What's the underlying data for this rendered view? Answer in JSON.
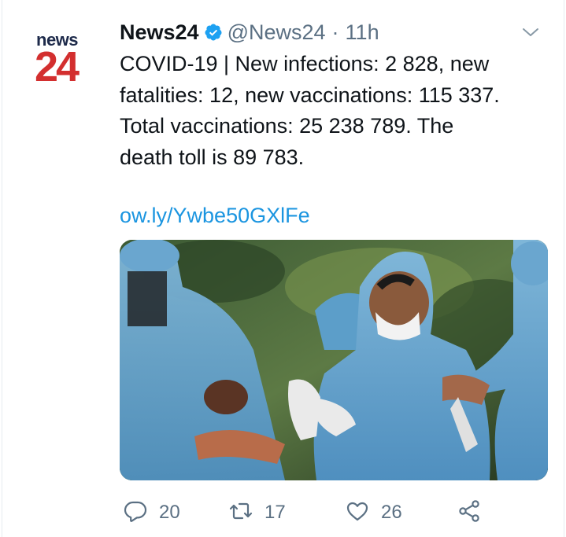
{
  "tweet": {
    "avatar_logo": {
      "top": "news",
      "bottom": "24"
    },
    "display_name": "News24",
    "handle": "@News24",
    "separator": "·",
    "time": "11h",
    "verified_icon": "verified-badge-icon",
    "text_lines": [
      "COVID-19 | New infections: 2 828, new",
      "fatalities: 12, new vaccinations: 115 337.",
      "Total vaccinations: 25 238 789. The",
      "death toll is 89 783."
    ],
    "link": "ow.ly/Ywbe50GXlFe",
    "media_description_icon": "photo",
    "actions": {
      "reply_count": "20",
      "retweet_count": "17",
      "like_count": "26"
    }
  },
  "colors": {
    "text": "#0f1419",
    "muted": "#5b7083",
    "link": "#1b95e0",
    "verified": "#1da1f2",
    "logo_red": "#d32f2f",
    "logo_navy": "#1d2a4a"
  }
}
